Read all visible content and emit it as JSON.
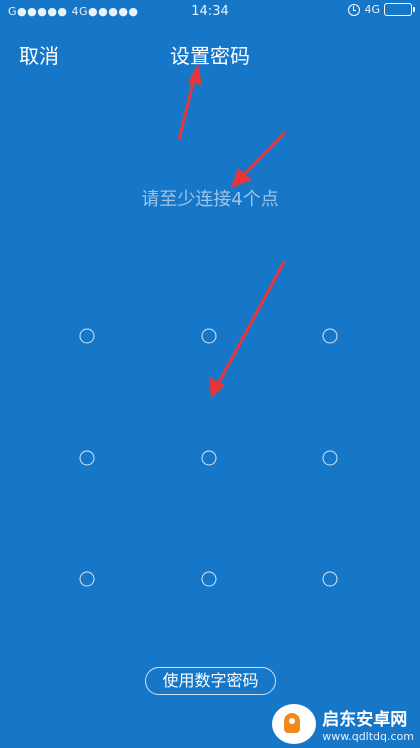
{
  "status_bar": {
    "left": "G●●●●● 4G●●●●●",
    "time": "14:34",
    "network": "4G"
  },
  "header": {
    "cancel_label": "取消",
    "title": "设置密码"
  },
  "hint": "请至少连接4个点",
  "pattern": {
    "dots": 9,
    "rows": 3,
    "cols": 3
  },
  "numeric_password_button": "使用数字密码",
  "watermark": {
    "title": "启东安卓网",
    "url": "www.qdltdq.com"
  },
  "colors": {
    "background": "#1677c9",
    "hint": "#9fc3e6",
    "arrow": "#e8353b"
  }
}
